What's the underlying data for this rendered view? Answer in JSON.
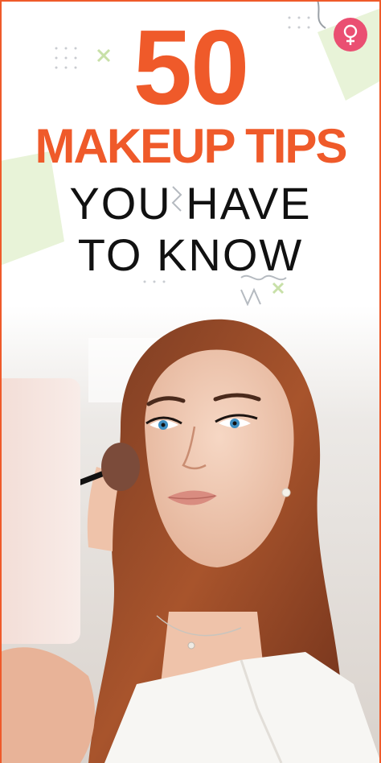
{
  "headline": {
    "number": "50",
    "title": "MAKEUP TIPS",
    "subtitle_line1": "YOU HAVE",
    "subtitle_line2": "TO KNOW"
  },
  "colors": {
    "accent": "#ef5a2a",
    "text_dark": "#111111",
    "logo": "#ea4f72",
    "deco_green": "#e8f3d8"
  },
  "icons": {
    "logo": "female-symbol-icon"
  }
}
